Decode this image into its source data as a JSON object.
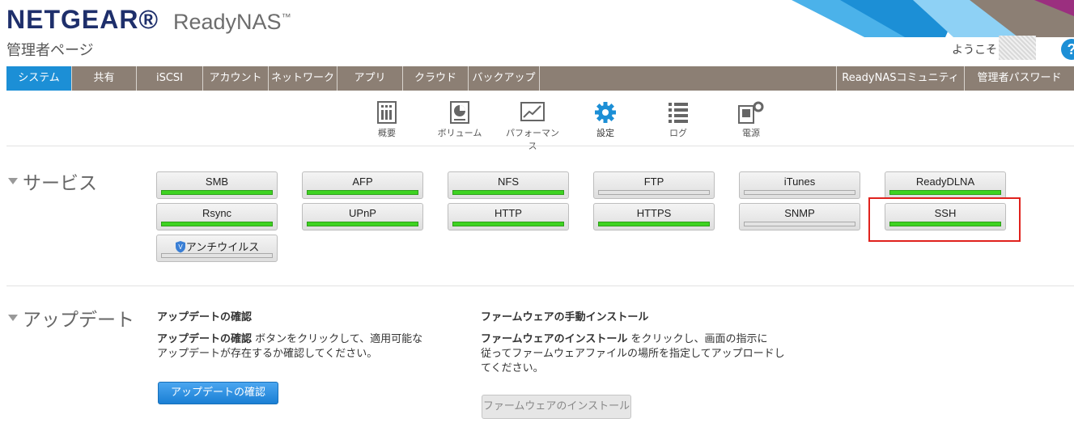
{
  "brand": {
    "logo": "NETGEAR®",
    "product": "ReadyNAS",
    "tm": "™",
    "subtitle": "管理者ページ"
  },
  "user": {
    "welcome": "ようこそ",
    "help": "?"
  },
  "colors": {
    "accent": "#1c8fd6",
    "nav_bg": "#8c7f74",
    "status_on": "#3ed321",
    "highlight": "#e0221d"
  },
  "nav": {
    "left": [
      "システム",
      "共有",
      "iSCSI",
      "アカウント",
      "ネットワーク",
      "アプリ",
      "クラウド",
      "バックアップ"
    ],
    "right": [
      "ReadyNASコミュニティ",
      "管理者パスワード"
    ],
    "active": "システム"
  },
  "subnav": [
    {
      "label": "概要",
      "icon": "overview-icon"
    },
    {
      "label": "ボリューム",
      "icon": "volume-icon"
    },
    {
      "label": "パフォーマンス",
      "icon": "performance-icon"
    },
    {
      "label": "設定",
      "icon": "gear-icon",
      "active": true
    },
    {
      "label": "ログ",
      "icon": "log-icon"
    },
    {
      "label": "電源",
      "icon": "power-icon"
    }
  ],
  "services": {
    "title": "サービス",
    "items": [
      {
        "name": "SMB",
        "enabled": true
      },
      {
        "name": "AFP",
        "enabled": true
      },
      {
        "name": "NFS",
        "enabled": true
      },
      {
        "name": "FTP",
        "enabled": false
      },
      {
        "name": "iTunes",
        "enabled": false
      },
      {
        "name": "ReadyDLNA",
        "enabled": true
      },
      {
        "name": "Rsync",
        "enabled": true
      },
      {
        "name": "UPnP",
        "enabled": true
      },
      {
        "name": "HTTP",
        "enabled": true
      },
      {
        "name": "HTTPS",
        "enabled": true
      },
      {
        "name": "SNMP",
        "enabled": false
      },
      {
        "name": "SSH",
        "enabled": true,
        "highlighted": true
      },
      {
        "name": "アンチウイルス",
        "enabled": false,
        "icon": "shield-icon"
      }
    ]
  },
  "update": {
    "title": "アップデート",
    "check": {
      "heading": "アップデートの確認",
      "bold": "アップデートの確認",
      "line1": " ボタンをクリックして、適用可能な",
      "line2": "アップデートが存在するか確認してください。",
      "button": "アップデートの確認"
    },
    "firmware": {
      "heading": "ファームウェアの手動インストール",
      "bold": "ファームウェアのインストール",
      "line1": " をクリックし、画面の指示に",
      "line2": "従ってファームウェアファイルの場所を指定してアップロードし",
      "line3": "てください。",
      "button": "ファームウェアのインストール"
    }
  }
}
